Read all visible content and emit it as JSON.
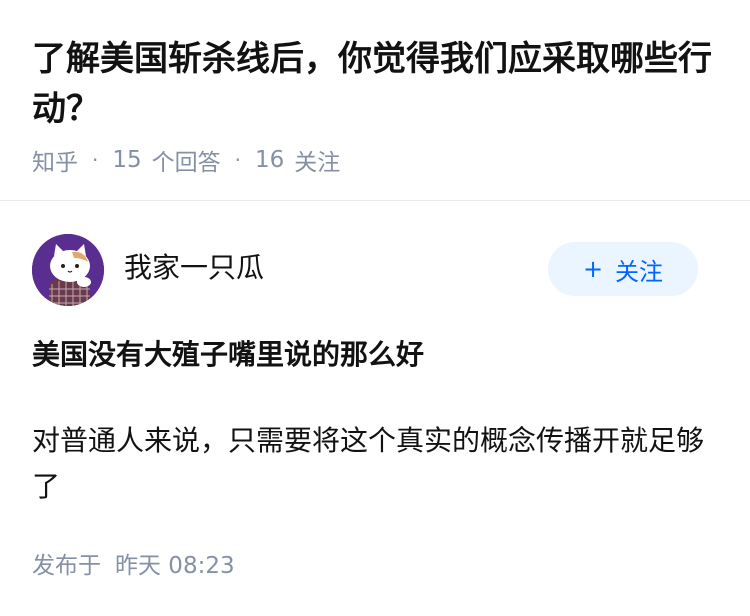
{
  "question": {
    "title": "了解美国斩杀线后，你觉得我们应采取哪些行动？",
    "source": "知乎",
    "separator": "·",
    "answer_count": "15",
    "answer_label": "个回答",
    "follower_count": "16",
    "follower_label": "关注"
  },
  "answer": {
    "author": {
      "name": "我家一只瓜",
      "avatar_icon": "cartoon-cat-avatar-icon",
      "follow_label": "关注",
      "follow_icon": "plus-icon"
    },
    "headline": "美国没有大殖子嘴里说的那么好",
    "body": "对普通人来说，只需要将这个真实的概念传播开就足够了",
    "published_label": "发布于",
    "published_time": "昨天 08:23"
  },
  "colors": {
    "accent": "#0066ff",
    "follow_bg": "#ebf5ff",
    "meta_text": "#8590a6",
    "avatar_bg": "#5a2d91"
  }
}
